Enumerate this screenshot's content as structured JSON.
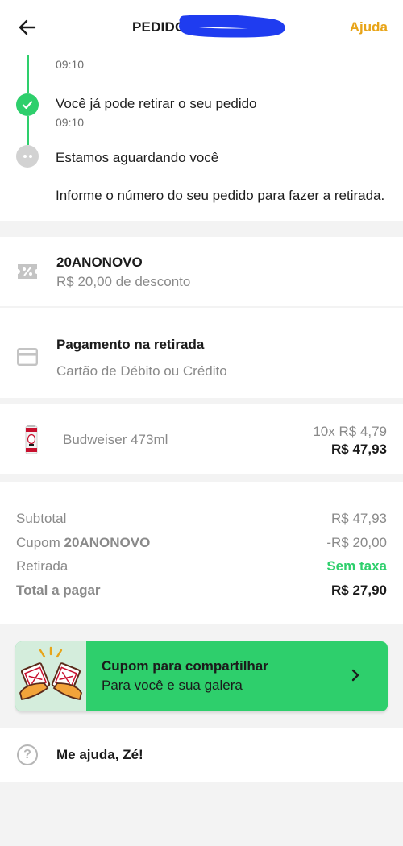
{
  "header": {
    "title": "PEDIDO",
    "help_label": "Ajuda",
    "back_icon": "arrow-left-icon"
  },
  "timeline": {
    "steps": [
      {
        "label": "",
        "time": "09:10",
        "status": "done"
      },
      {
        "label": "Você já pode retirar o seu pedido",
        "time": "09:10",
        "status": "done"
      },
      {
        "label": "Estamos aguardando você",
        "time": "",
        "status": "waiting"
      }
    ],
    "instruction": "Informe o número do seu pedido para fazer a retirada."
  },
  "coupon": {
    "code": "20ANONOVO",
    "description": "R$ 20,00 de desconto",
    "icon": "discount-ticket-icon"
  },
  "payment": {
    "title": "Pagamento na retirada",
    "method": "Cartão de Débito ou Crédito",
    "icon": "credit-card-icon"
  },
  "product": {
    "name": "Budweiser 473ml",
    "unit_price": "10x R$ 4,79",
    "total": "R$ 47,93"
  },
  "summary": {
    "subtotal_label": "Subtotal",
    "subtotal_value": "R$ 47,93",
    "coupon_label": "Cupom",
    "coupon_code": "20ANONOVO",
    "coupon_value": "-R$ 20,00",
    "pickup_label": "Retirada",
    "pickup_value": "Sem taxa",
    "total_label": "Total a pagar",
    "total_value": "R$ 27,90"
  },
  "share_banner": {
    "title": "Cupom para compartilhar",
    "subtitle": "Para você e sua galera"
  },
  "help_row": {
    "label": "Me ajuda, Zé!",
    "icon": "question-circle-icon"
  },
  "colors": {
    "accent_green": "#2ecf6c",
    "help_orange": "#e8a418",
    "scribble_blue": "#1f3cf0"
  }
}
